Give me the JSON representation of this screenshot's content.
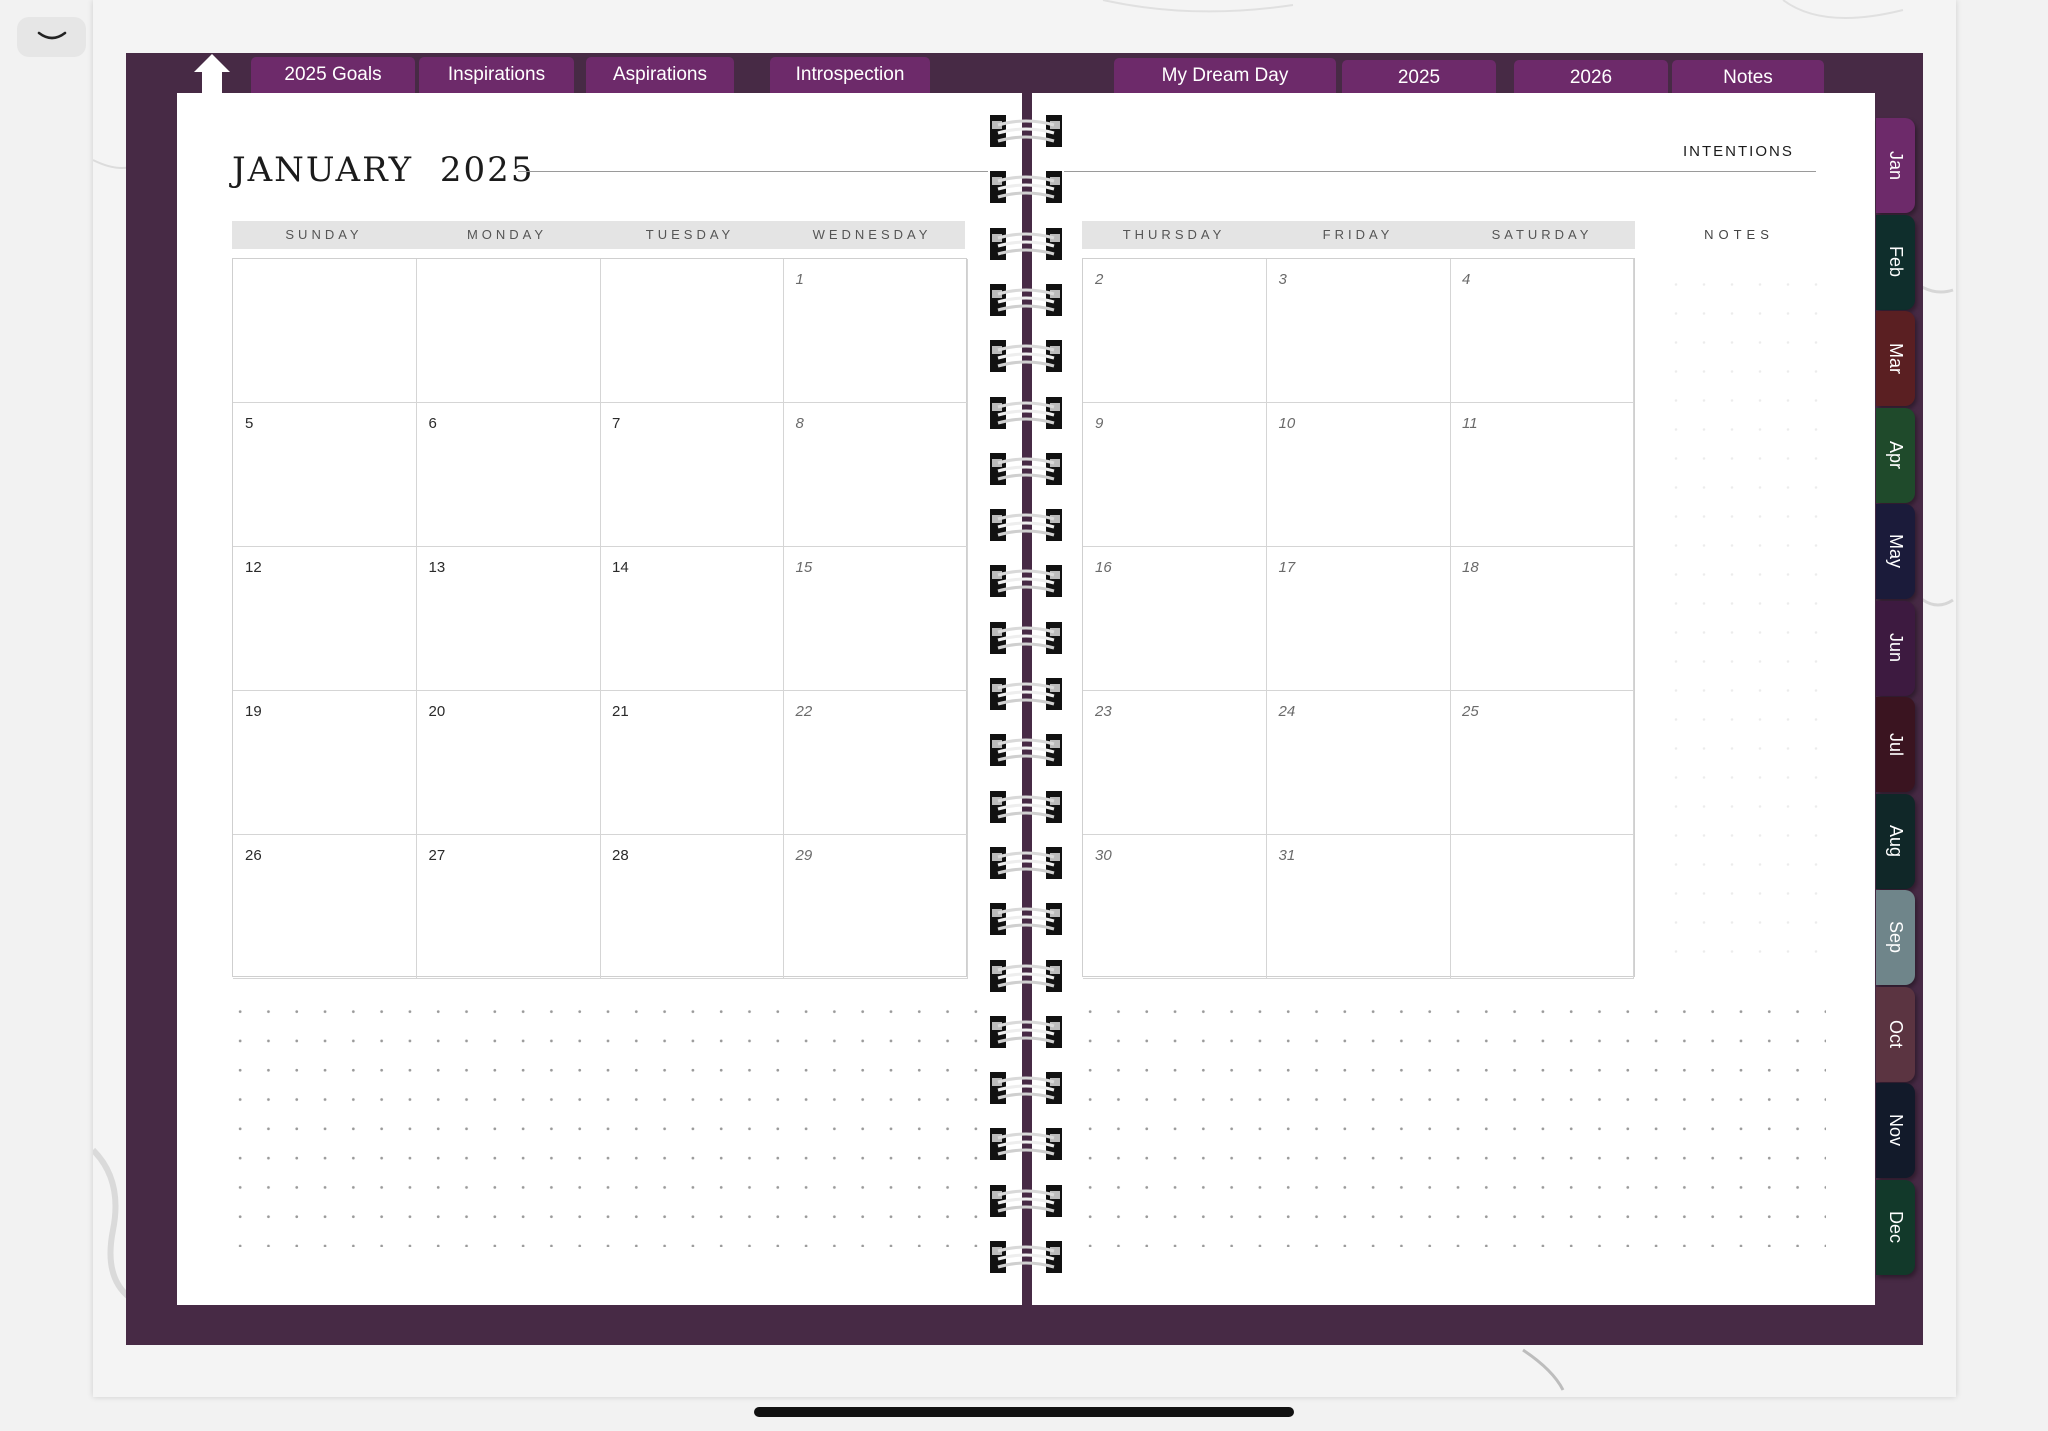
{
  "top_tabs_left": [
    "2025 Goals",
    "Inspirations",
    "Aspirations",
    "Introspection"
  ],
  "top_tabs_right": [
    "My Dream Day",
    "2025",
    "2026",
    "Notes"
  ],
  "month_title": "JANUARY",
  "year_title": "2025",
  "intentions_label": "INTENTIONS",
  "notes_label": "NOTES",
  "weekdays_left": [
    "SUNDAY",
    "MONDAY",
    "TUESDAY",
    "WEDNESDAY"
  ],
  "weekdays_right": [
    "THURSDAY",
    "FRIDAY",
    "SATURDAY"
  ],
  "calendar_left": [
    [
      "",
      "",
      "",
      "1"
    ],
    [
      "5",
      "6",
      "7",
      "8"
    ],
    [
      "12",
      "13",
      "14",
      "15"
    ],
    [
      "19",
      "20",
      "21",
      "22"
    ],
    [
      "26",
      "27",
      "28",
      "29"
    ]
  ],
  "calendar_right": [
    [
      "2",
      "3",
      "4"
    ],
    [
      "9",
      "10",
      "11"
    ],
    [
      "16",
      "17",
      "18"
    ],
    [
      "23",
      "24",
      "25"
    ],
    [
      "30",
      "31",
      ""
    ]
  ],
  "month_tabs": [
    {
      "label": "Jan",
      "color": "#6d2a6a"
    },
    {
      "label": "Feb",
      "color": "#0f2e2c"
    },
    {
      "label": "Mar",
      "color": "#5a1f22"
    },
    {
      "label": "Apr",
      "color": "#1f4a2b"
    },
    {
      "label": "May",
      "color": "#1b1b3a"
    },
    {
      "label": "Jun",
      "color": "#3d1a40"
    },
    {
      "label": "Jul",
      "color": "#3a1420"
    },
    {
      "label": "Aug",
      "color": "#102728"
    },
    {
      "label": "Sep",
      "color": "#6f858a"
    },
    {
      "label": "Oct",
      "color": "#5b3441"
    },
    {
      "label": "Nov",
      "color": "#121a2a"
    },
    {
      "label": "Dec",
      "color": "#12392a"
    }
  ],
  "colors": {
    "cover": "#472a45",
    "tab": "#6d2a6a",
    "page": "#ffffff"
  }
}
